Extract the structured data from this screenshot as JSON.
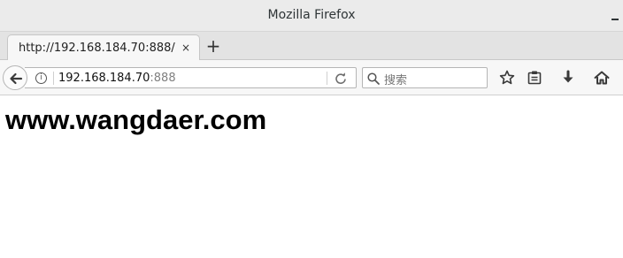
{
  "window": {
    "title": "Mozilla Firefox"
  },
  "tabs": [
    {
      "title": "http://192.168.184.70:888/",
      "close_symbol": "×"
    }
  ],
  "new_tab_symbol": "+",
  "urlbar": {
    "host": "192.168.184.70",
    "port": ":888"
  },
  "search": {
    "placeholder": "搜索"
  },
  "page": {
    "heading": "www.wangdaer.com"
  },
  "icons": {
    "back": "back-arrow-icon",
    "info": "info-icon",
    "reload": "reload-icon",
    "search": "search-icon",
    "bookmark": "star-icon",
    "library": "clipboard-icon",
    "downloads": "download-arrow-icon",
    "home": "home-icon"
  }
}
